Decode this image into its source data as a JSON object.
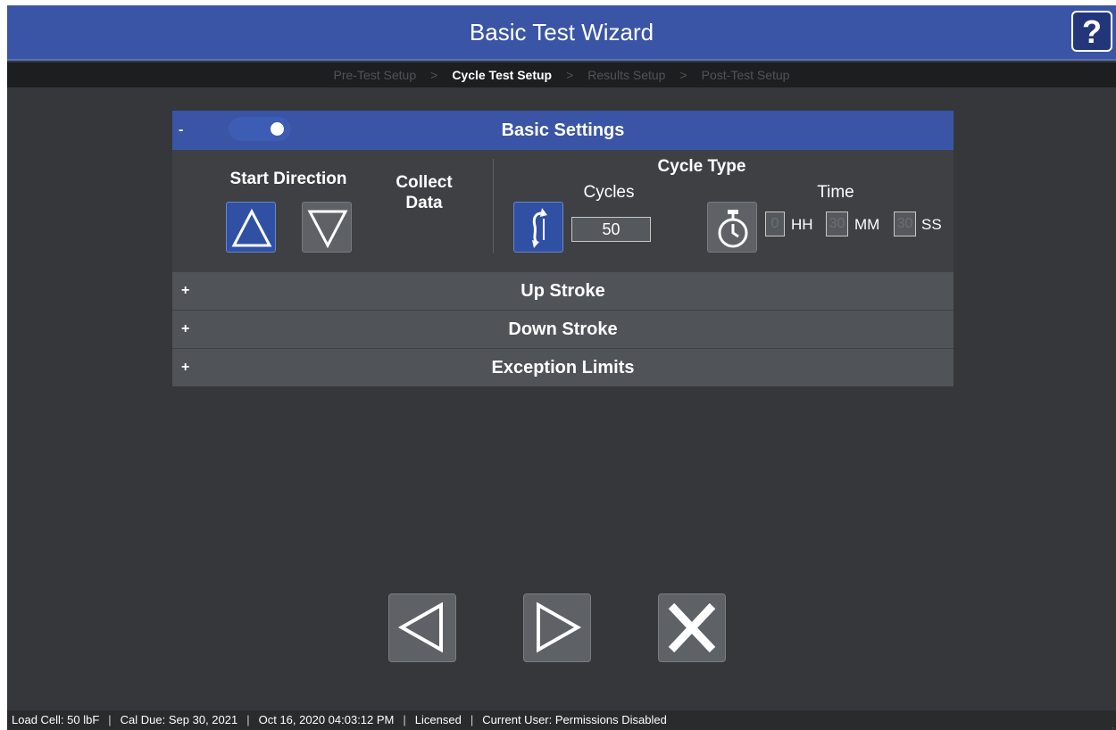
{
  "window": {
    "title": "Basic Test Wizard",
    "help_label": "?"
  },
  "breadcrumbs": [
    {
      "label": "Pre-Test Setup",
      "active": false
    },
    {
      "label": ">",
      "active": false
    },
    {
      "label": "Cycle Test Setup",
      "active": true
    },
    {
      "label": ">",
      "active": false
    },
    {
      "label": "Results Setup",
      "active": false
    },
    {
      "label": ">",
      "active": false
    },
    {
      "label": "Post-Test Setup",
      "active": false
    }
  ],
  "basic_settings": {
    "title": "Basic Settings",
    "toggle": "-",
    "start_direction": {
      "label": "Start Direction",
      "selected": "up"
    },
    "collect_data": {
      "label_line1": "Collect",
      "label_line2": "Data",
      "on": true
    },
    "cycle_type": {
      "label": "Cycle Type",
      "cycles_label": "Cycles",
      "cycles_value": "50",
      "time_label": "Time",
      "hh_value": "0",
      "hh_label": "HH",
      "mm_value": "30",
      "mm_label": "MM",
      "ss_value": "30",
      "ss_label": "SS"
    }
  },
  "sections": [
    {
      "toggle": "+",
      "title": "Up Stroke"
    },
    {
      "toggle": "+",
      "title": "Down Stroke"
    },
    {
      "toggle": "+",
      "title": "Exception Limits"
    }
  ],
  "navigation": {
    "back": "back-arrow-icon",
    "next": "next-arrow-icon",
    "close": "close-icon"
  },
  "status_bar": {
    "load_cell": "Load Cell: 50 lbF",
    "cal_due": "Cal Due: Sep 30, 2021",
    "datetime": "Oct 16, 2020 04:03:12 PM",
    "license": "Licensed",
    "user": "Current User: Permissions Disabled",
    "separator": "|"
  },
  "colors": {
    "accent": "#3a55a6",
    "background": "#35373a",
    "button_gray": "#5e6166"
  }
}
